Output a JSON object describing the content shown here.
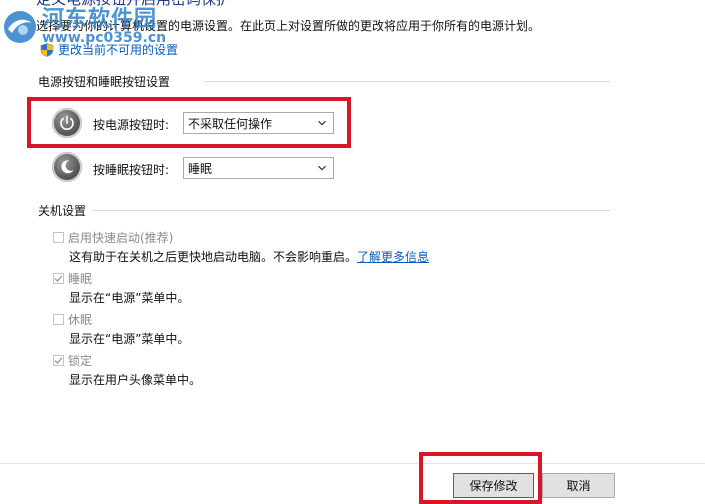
{
  "header": {
    "title": "定义电源按钮并启用密码保护",
    "intro": "选择要为你的计算机设置的电源设置。在此页上对设置所做的更改将应用于你所有的电源计划。",
    "unavailable_link": "更改当前不可用的设置"
  },
  "watermark": {
    "text_cn": "河东软件园",
    "url": "www.pc0359.cn"
  },
  "power_buttons": {
    "section_title": "电源按钮和睡眠按钮设置",
    "power_button": {
      "label": "按电源按钮时:",
      "value": "不采取任何操作"
    },
    "sleep_button": {
      "label": "按睡眠按钮时:",
      "value": "睡眠"
    }
  },
  "shutdown": {
    "section_title": "关机设置",
    "options": [
      {
        "label": "启用快速启动(推荐)",
        "checked": false,
        "desc": "这有助于在关机之后更快地启动电脑。不会影响重启。",
        "link": "了解更多信息"
      },
      {
        "label": "睡眠",
        "checked": true,
        "desc": "显示在“电源”菜单中。"
      },
      {
        "label": "休眠",
        "checked": false,
        "desc": "显示在“电源”菜单中。"
      },
      {
        "label": "锁定",
        "checked": true,
        "desc": "显示在用户头像菜单中。"
      }
    ]
  },
  "footer": {
    "save_label": "保存修改",
    "cancel_label": "取消"
  },
  "colors": {
    "highlight_red": "#d8162a",
    "link_blue": "#0a5bbf",
    "title_blue": "#1b3a8a"
  }
}
